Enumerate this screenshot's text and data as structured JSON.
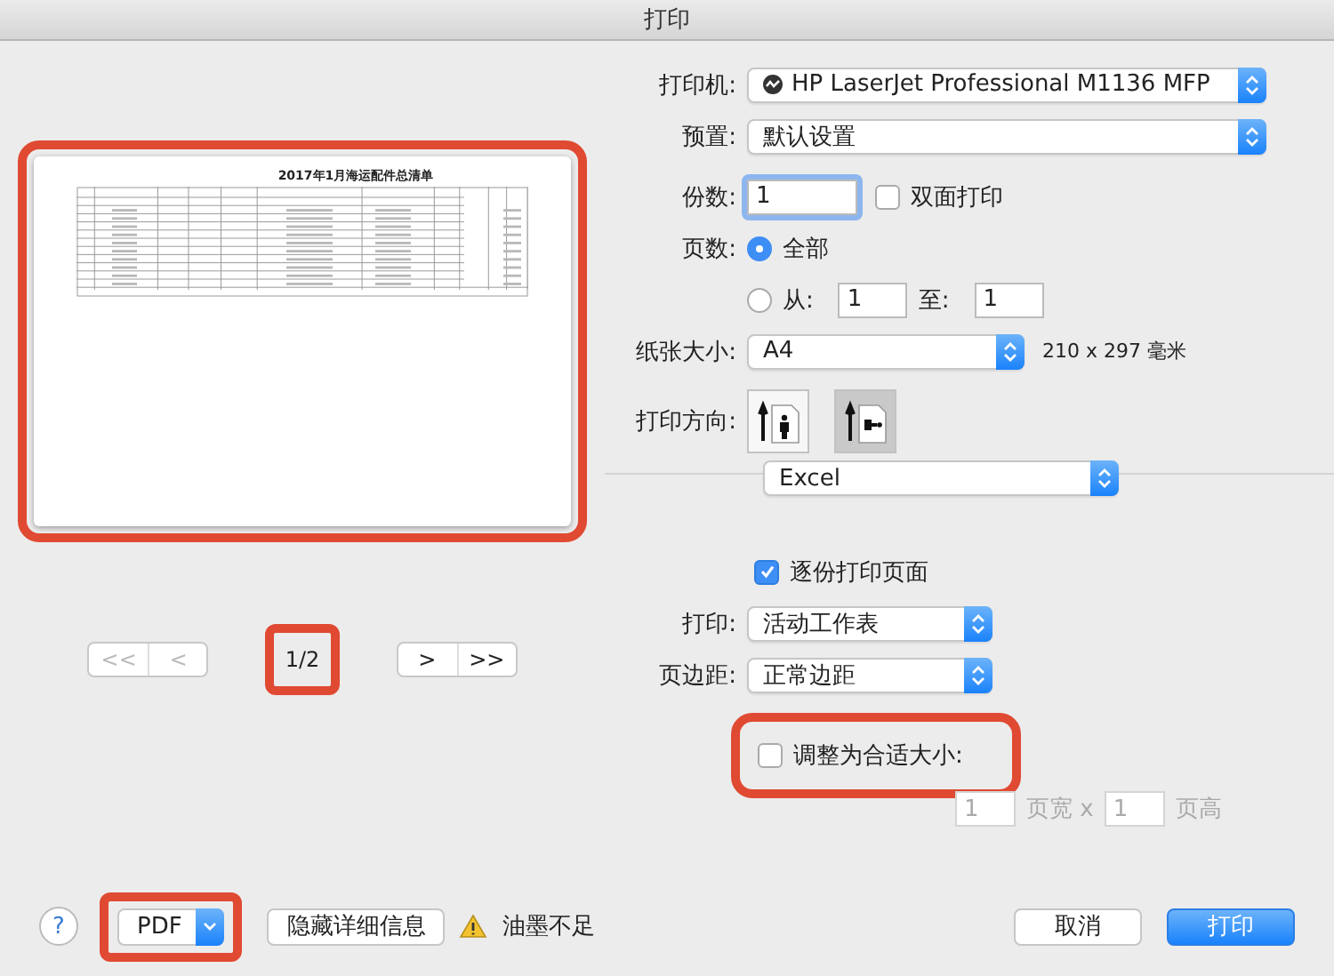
{
  "window": {
    "title": "打印"
  },
  "preview": {
    "highlighted": true,
    "document_title": "2017年1月海运配件总清单",
    "page_indicator": "1/2",
    "indicator_highlighted": true,
    "nav_buttons": [
      {
        "label": "<<",
        "disabled": true
      },
      {
        "label": "<",
        "disabled": true
      },
      {
        "label": ">",
        "disabled": false
      },
      {
        "label": ">>",
        "disabled": false
      }
    ]
  },
  "printer": {
    "label": "打印机:",
    "value": "HP LaserJet Professional M1136 MFP"
  },
  "presets": {
    "label": "预置:",
    "value": "默认设置"
  },
  "copies": {
    "label": "份数:",
    "value": "1",
    "duplex": {
      "label": "双面打印",
      "checked": false
    }
  },
  "pages": {
    "label": "页数:",
    "options": [
      {
        "label": "全部",
        "selected": true
      },
      {
        "label": "从:",
        "selected": false
      }
    ],
    "from": "1",
    "to_label": "至:",
    "to": "1"
  },
  "paper_size": {
    "label": "纸张大小:",
    "value": "A4",
    "dimensions": "210 x 297 毫米"
  },
  "orientation": {
    "label": "打印方向:",
    "options": [
      {
        "kind": "portrait",
        "selected": false
      },
      {
        "kind": "landscape",
        "selected": true
      }
    ]
  },
  "section_menu": {
    "value": "Excel"
  },
  "collate": {
    "label": "逐份打印页面",
    "checked": true
  },
  "print_what": {
    "label": "打印:",
    "value": "活动工作表"
  },
  "margins": {
    "label": "页边距:",
    "value": "正常边距"
  },
  "scale_to_fit": {
    "label": "调整为合适大小:",
    "checked": false,
    "highlighted": true,
    "pages_wide": "1",
    "wide_label": "页宽 x",
    "pages_tall": "1",
    "tall_label": "页高"
  },
  "footer": {
    "help": "?",
    "pdf": "PDF",
    "pdf_highlighted": true,
    "hide_details": "隐藏详细信息",
    "warning": "油墨不足",
    "buttons": [
      {
        "label": "取消",
        "default": false
      },
      {
        "label": "打印",
        "default": true
      }
    ]
  }
}
